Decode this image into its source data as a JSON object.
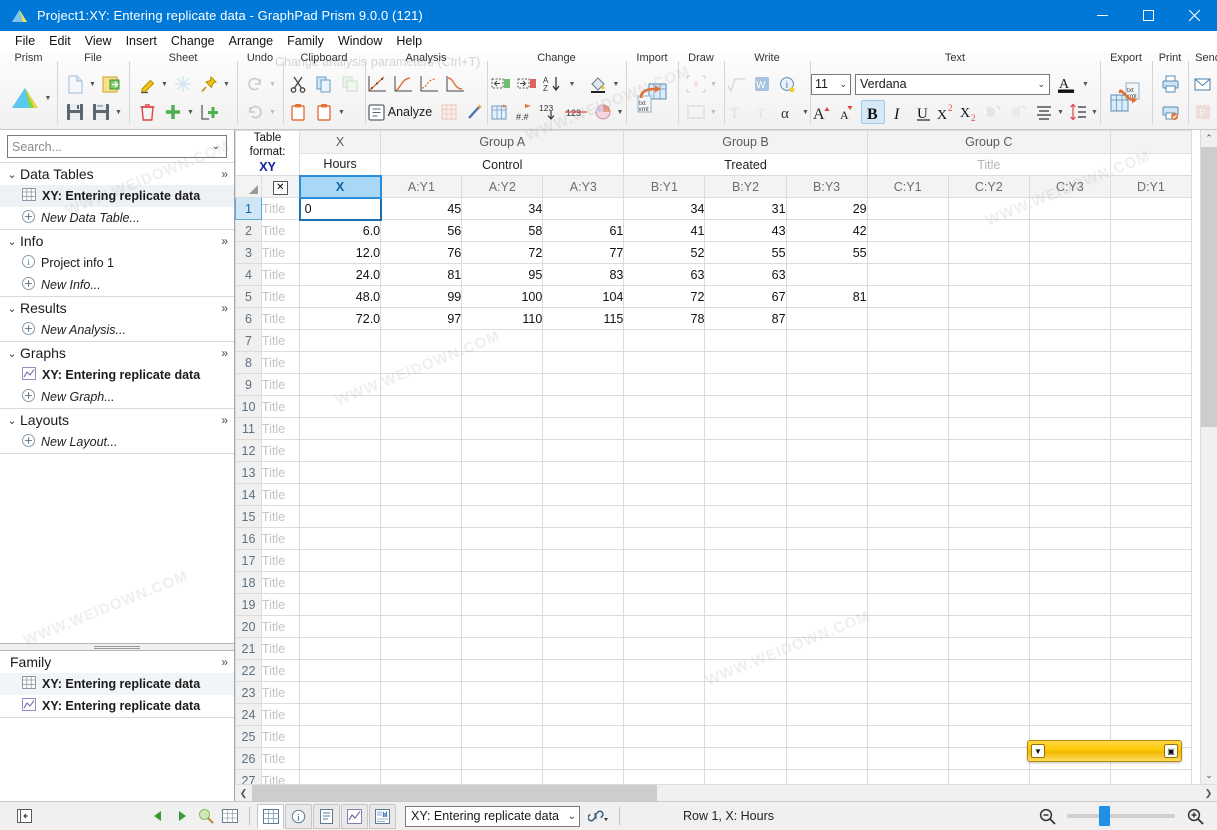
{
  "window": {
    "title": "Project1:XY: Entering replicate data - GraphPad Prism 9.0.0 (121)",
    "minimize": "—",
    "maximize": "☐",
    "close": "✕",
    "accent": "#0078d7"
  },
  "menubar": {
    "items": [
      "File",
      "Edit",
      "View",
      "Insert",
      "Change",
      "Arrange",
      "Family",
      "Window",
      "Help"
    ]
  },
  "ribbon": {
    "groups": [
      {
        "label": "Prism",
        "icons": [
          "prism-logo-icon"
        ]
      },
      {
        "label": "File",
        "icons": [
          "new-file-icon",
          "open-file-icon",
          "save-icon",
          "save-as-icon"
        ]
      },
      {
        "label": "Sheet",
        "icons": [
          "highlight-icon",
          "freeze-icon",
          "pin-icon",
          "delete-sheet-icon",
          "add-sheet-icon",
          "duplicate-sheet-icon"
        ]
      },
      {
        "label": "Undo",
        "icons": [
          "redo-icon",
          "undo-icon"
        ]
      },
      {
        "label": "Clipboard",
        "icons": [
          "cut-icon",
          "copy-icon",
          "paste-special-icon",
          "paste-icon",
          "paste-menu-icon"
        ]
      },
      {
        "label": "Analysis",
        "icons": [
          "linear-regression-icon",
          "nonlinear-fit-icon",
          "smooth-curve-icon",
          "dose-response-icon",
          "analyze-icon",
          "results-table-icon",
          "wizard-icon"
        ]
      },
      {
        "label": "Change",
        "icons": [
          "indent-left-icon",
          "indent-right-icon",
          "sort-az-icon",
          "fill-color-icon",
          "table-format-icon",
          "decimal-icon",
          "number-format-icon",
          "strike-number-icon",
          "color-scheme-icon"
        ]
      },
      {
        "label": "Import",
        "icons": [
          "import-txt-xml-icon"
        ]
      },
      {
        "label": "Draw",
        "icons": [
          "draw-shape-icon",
          "rectangle-icon"
        ]
      },
      {
        "label": "Write",
        "icons": [
          "equation-icon",
          "word-icon",
          "info-icon",
          "text-box-icon",
          "text-icon",
          "greek-symbol-icon"
        ]
      },
      {
        "label": "Text",
        "icons": [
          "font-grow-icon",
          "font-shrink-icon",
          "bold-icon",
          "italic-icon",
          "underline-icon",
          "superscript-icon",
          "subscript-icon",
          "undo-format-icon",
          "redo-format-icon",
          "align-icon",
          "line-spacing-icon"
        ]
      },
      {
        "label": "Export",
        "icons": [
          "export-txt-xml-icon"
        ]
      },
      {
        "label": "Print",
        "icons": [
          "print-icon",
          "print-preview-icon"
        ]
      },
      {
        "label": "Send",
        "icons": [
          "email-icon",
          "powerpoint-icon"
        ]
      }
    ],
    "analyze_label": "Analyze",
    "font_size": "11",
    "font_name": "Verdana"
  },
  "sidebar": {
    "search_placeholder": "Search...",
    "sections": [
      {
        "title": "Data Tables",
        "items": [
          {
            "label": "XY: Entering replicate data",
            "icon": "data-table-icon",
            "style": "bold",
            "selected": true
          },
          {
            "label": "New Data Table...",
            "icon": "plus-circle-icon",
            "style": "italic",
            "selected": false
          }
        ]
      },
      {
        "title": "Info",
        "items": [
          {
            "label": "Project info 1",
            "icon": "info-circle-icon",
            "style": "normal",
            "selected": false
          },
          {
            "label": "New Info...",
            "icon": "plus-circle-icon",
            "style": "italic",
            "selected": false
          }
        ]
      },
      {
        "title": "Results",
        "items": [
          {
            "label": "New Analysis...",
            "icon": "plus-circle-icon",
            "style": "italic",
            "selected": false
          }
        ]
      },
      {
        "title": "Graphs",
        "items": [
          {
            "label": "XY: Entering replicate data",
            "icon": "graph-icon",
            "style": "bold",
            "selected": false
          },
          {
            "label": "New Graph...",
            "icon": "plus-circle-icon",
            "style": "italic",
            "selected": false
          }
        ]
      },
      {
        "title": "Layouts",
        "items": [
          {
            "label": "New Layout...",
            "icon": "plus-circle-icon",
            "style": "italic",
            "selected": false
          }
        ]
      }
    ],
    "family": {
      "title": "Family",
      "items": [
        {
          "label": "XY: Entering replicate data",
          "icon": "data-table-icon",
          "selected": true
        },
        {
          "label": "XY: Entering replicate data",
          "icon": "graph-icon",
          "selected": false
        }
      ]
    }
  },
  "table": {
    "format_label": "Table format:",
    "format_value": "XY",
    "row_title_placeholder": "Title",
    "groups": [
      {
        "name": "X",
        "title": "Hours",
        "title_is_placeholder": false,
        "span": 1
      },
      {
        "name": "Group A",
        "title": "Control",
        "title_is_placeholder": false,
        "span": 3
      },
      {
        "name": "Group B",
        "title": "Treated",
        "title_is_placeholder": false,
        "span": 3
      },
      {
        "name": "Group C",
        "title": "Title",
        "title_is_placeholder": true,
        "span": 3
      },
      {
        "name": "",
        "title": "",
        "title_is_placeholder": true,
        "span": 1
      }
    ],
    "columns": [
      "X",
      "A:Y1",
      "A:Y2",
      "A:Y3",
      "B:Y1",
      "B:Y2",
      "B:Y3",
      "C:Y1",
      "C:Y2",
      "C:Y3",
      "D:Y1"
    ],
    "selected_column": "X",
    "active_cell": {
      "row": 1,
      "column": "X",
      "value": "0"
    },
    "rows": [
      {
        "n": 1,
        "values": [
          "0",
          "45",
          "34",
          "",
          "34",
          "31",
          "29",
          "",
          "",
          "",
          ""
        ]
      },
      {
        "n": 2,
        "values": [
          "6.0",
          "56",
          "58",
          "61",
          "41",
          "43",
          "42",
          "",
          "",
          "",
          ""
        ]
      },
      {
        "n": 3,
        "values": [
          "12.0",
          "76",
          "72",
          "77",
          "52",
          "55",
          "55",
          "",
          "",
          "",
          ""
        ]
      },
      {
        "n": 4,
        "values": [
          "24.0",
          "81",
          "95",
          "83",
          "63",
          "63",
          "",
          "",
          "",
          "",
          ""
        ]
      },
      {
        "n": 5,
        "values": [
          "48.0",
          "99",
          "100",
          "104",
          "72",
          "67",
          "81",
          "",
          "",
          "",
          ""
        ]
      },
      {
        "n": 6,
        "values": [
          "72.0",
          "97",
          "110",
          "115",
          "78",
          "87",
          "",
          "",
          "",
          "",
          ""
        ]
      },
      {
        "n": 7,
        "values": [
          "",
          "",
          "",
          "",
          "",
          "",
          "",
          "",
          "",
          "",
          ""
        ]
      },
      {
        "n": 8,
        "values": [
          "",
          "",
          "",
          "",
          "",
          "",
          "",
          "",
          "",
          "",
          ""
        ]
      },
      {
        "n": 9,
        "values": [
          "",
          "",
          "",
          "",
          "",
          "",
          "",
          "",
          "",
          "",
          ""
        ]
      },
      {
        "n": 10,
        "values": [
          "",
          "",
          "",
          "",
          "",
          "",
          "",
          "",
          "",
          "",
          ""
        ]
      },
      {
        "n": 11,
        "values": [
          "",
          "",
          "",
          "",
          "",
          "",
          "",
          "",
          "",
          "",
          ""
        ]
      },
      {
        "n": 12,
        "values": [
          "",
          "",
          "",
          "",
          "",
          "",
          "",
          "",
          "",
          "",
          ""
        ]
      },
      {
        "n": 13,
        "values": [
          "",
          "",
          "",
          "",
          "",
          "",
          "",
          "",
          "",
          "",
          ""
        ]
      },
      {
        "n": 14,
        "values": [
          "",
          "",
          "",
          "",
          "",
          "",
          "",
          "",
          "",
          "",
          ""
        ]
      },
      {
        "n": 15,
        "values": [
          "",
          "",
          "",
          "",
          "",
          "",
          "",
          "",
          "",
          "",
          ""
        ]
      },
      {
        "n": 16,
        "values": [
          "",
          "",
          "",
          "",
          "",
          "",
          "",
          "",
          "",
          "",
          ""
        ]
      },
      {
        "n": 17,
        "values": [
          "",
          "",
          "",
          "",
          "",
          "",
          "",
          "",
          "",
          "",
          ""
        ]
      },
      {
        "n": 18,
        "values": [
          "",
          "",
          "",
          "",
          "",
          "",
          "",
          "",
          "",
          "",
          ""
        ]
      },
      {
        "n": 19,
        "values": [
          "",
          "",
          "",
          "",
          "",
          "",
          "",
          "",
          "",
          "",
          ""
        ]
      },
      {
        "n": 20,
        "values": [
          "",
          "",
          "",
          "",
          "",
          "",
          "",
          "",
          "",
          "",
          ""
        ]
      },
      {
        "n": 21,
        "values": [
          "",
          "",
          "",
          "",
          "",
          "",
          "",
          "",
          "",
          "",
          ""
        ]
      },
      {
        "n": 22,
        "values": [
          "",
          "",
          "",
          "",
          "",
          "",
          "",
          "",
          "",
          "",
          ""
        ]
      },
      {
        "n": 23,
        "values": [
          "",
          "",
          "",
          "",
          "",
          "",
          "",
          "",
          "",
          "",
          ""
        ]
      },
      {
        "n": 24,
        "values": [
          "",
          "",
          "",
          "",
          "",
          "",
          "",
          "",
          "",
          "",
          ""
        ]
      },
      {
        "n": 25,
        "values": [
          "",
          "",
          "",
          "",
          "",
          "",
          "",
          "",
          "",
          "",
          ""
        ]
      },
      {
        "n": 26,
        "values": [
          "",
          "",
          "",
          "",
          "",
          "",
          "",
          "",
          "",
          "",
          ""
        ]
      },
      {
        "n": 27,
        "values": [
          "",
          "",
          "",
          "",
          "",
          "",
          "",
          "",
          "",
          "",
          ""
        ]
      }
    ]
  },
  "statusbar": {
    "sheet_name": "XY: Entering replicate data",
    "status_text": "Row 1, X: Hours",
    "tabs": [
      "sheet-table-tab",
      "info-tab",
      "results-tab",
      "graph-tab",
      "layout-tab"
    ],
    "nav_icons": [
      "prev-sheet-icon",
      "next-sheet-icon",
      "find-icon",
      "sheet-overview-icon"
    ],
    "zoom_out": "zoom-out-icon",
    "zoom_in": "zoom-in-icon"
  },
  "watermark": {
    "text": "WWW.WEIDOWN.COM"
  },
  "ghost_tooltip": "Change analysis parameters (Ctrl+T)"
}
